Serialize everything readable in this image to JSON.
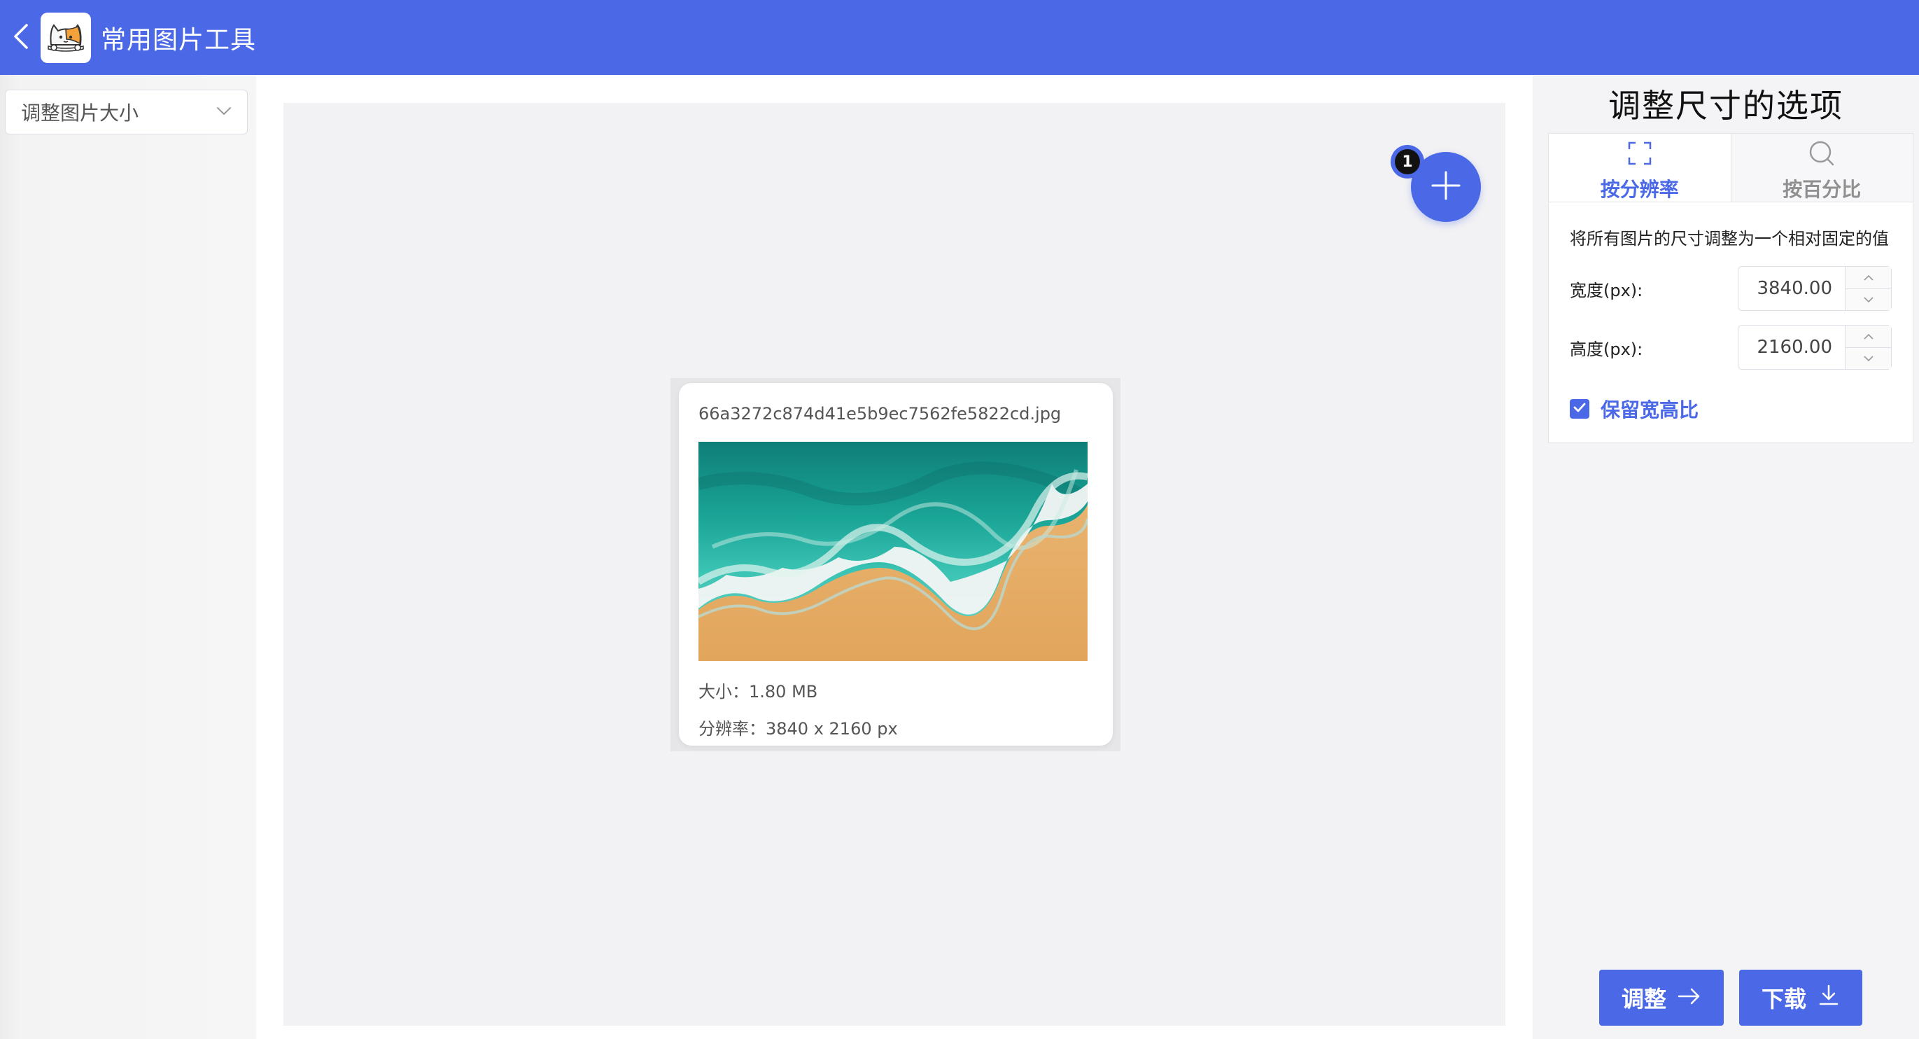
{
  "header": {
    "title": "常用图片工具",
    "back_icon": "chevron-left-icon",
    "logo_icon": "cat-logo-icon",
    "bg_color": "#4b68e6"
  },
  "sidebar": {
    "tool_select": {
      "value": "调整图片大小",
      "icon": "chevron-down-icon"
    }
  },
  "canvas": {
    "add_button_icon": "plus-icon",
    "file_count_badge": "1",
    "files": [
      {
        "name": "66a3272c874d41e5b9ec7562fe5822cd.jpg",
        "size_text": "大小：1.80 MB",
        "resolution_text": "分辨率：3840 x 2160 px"
      }
    ]
  },
  "options": {
    "title": "调整尺寸的选项",
    "tabs": [
      {
        "label": "按分辨率",
        "icon": "scan-frame-icon",
        "active": true
      },
      {
        "label": "按百分比",
        "icon": "search-icon",
        "active": false
      }
    ],
    "description": "将所有图片的尺寸调整为一个相对固定的值",
    "width": {
      "label": "宽度(px):",
      "value": "3840.00"
    },
    "height": {
      "label": "高度(px):",
      "value": "2160.00"
    },
    "keep_ratio": {
      "label": "保留宽高比",
      "checked": true
    }
  },
  "actions": {
    "adjust": {
      "label": "调整",
      "icon": "arrow-right-icon"
    },
    "download": {
      "label": "下载",
      "icon": "download-icon"
    }
  },
  "colors": {
    "accent": "#4b68e6",
    "canvas_bg": "#f2f2f4",
    "panel_bg": "#f4f4f6"
  }
}
